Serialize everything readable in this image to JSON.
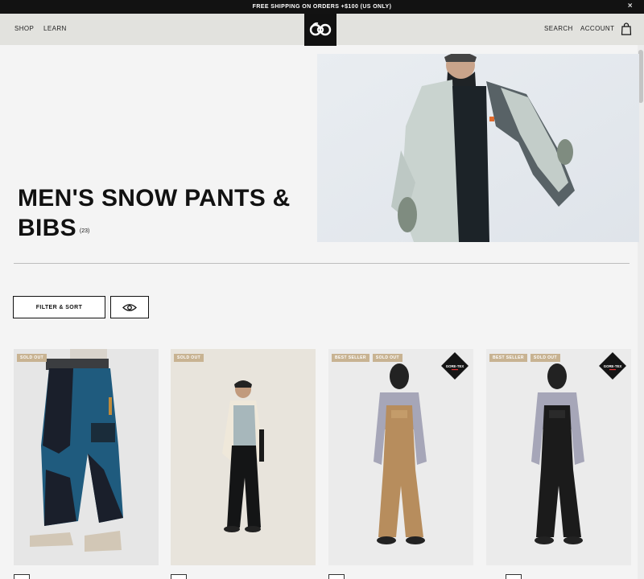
{
  "announcement": {
    "text": "FREE SHIPPING ON ORDERS +$100 (US ONLY)",
    "close": "×"
  },
  "nav": {
    "left": [
      "SHOP",
      "LEARN"
    ],
    "logo": "686",
    "right": [
      "SEARCH",
      "ACCOUNT"
    ]
  },
  "hero": {
    "title": "MEN'S SNOW PANTS & BIBS",
    "count": "(23)"
  },
  "controls": {
    "filter_label": "FILTER & SORT",
    "view_icon": "eye-icon"
  },
  "products": [
    {
      "badges": [
        "SOLD OUT"
      ],
      "gore_tex": false
    },
    {
      "badges": [
        "SOLD OUT"
      ],
      "gore_tex": false
    },
    {
      "badges": [
        "BEST SELLER",
        "SOLD OUT"
      ],
      "gore_tex": true
    },
    {
      "badges": [
        "BEST SELLER",
        "SOLD OUT"
      ],
      "gore_tex": true
    }
  ],
  "gore_tex_label": "GORE-TEX",
  "colors": {
    "announce_bg": "#121212",
    "nav_bg": "#e2e2de",
    "badge": "#c8b392",
    "page_bg": "#f4f4f4"
  }
}
